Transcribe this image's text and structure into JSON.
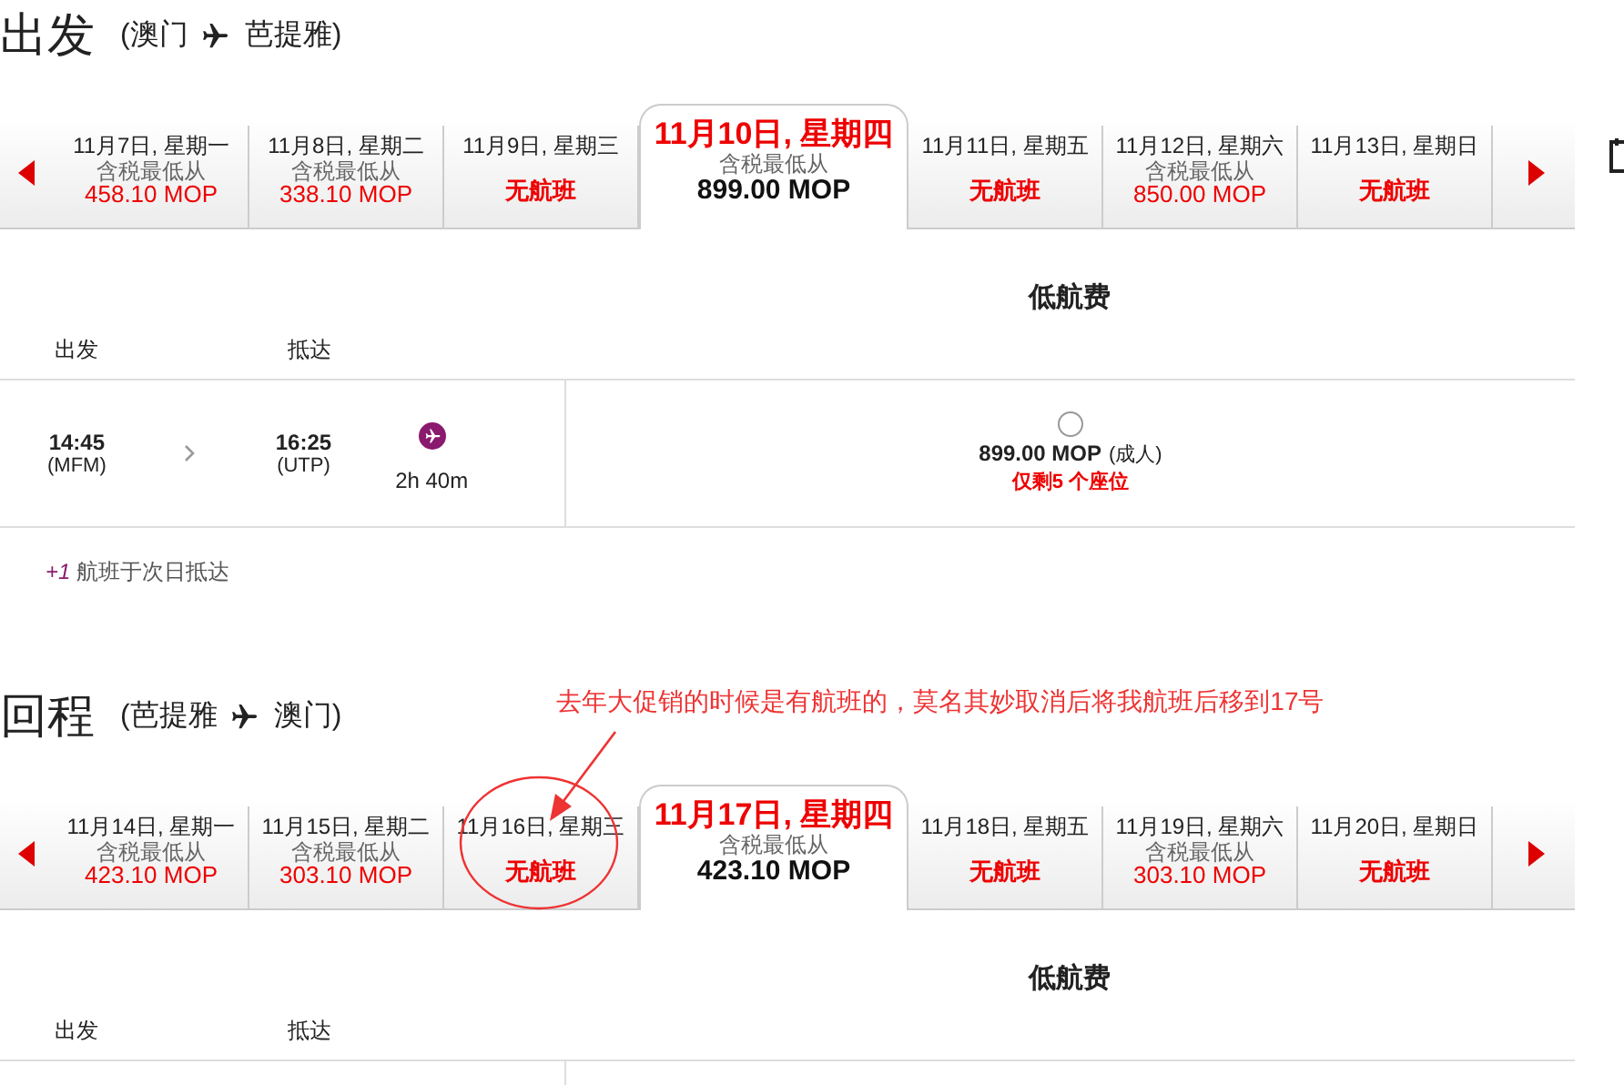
{
  "sections": [
    {
      "title": "出发",
      "route": {
        "from": "(澳门",
        "to": "芭提雅)"
      },
      "dates": [
        {
          "date": "11月7日, 星期一",
          "kind": "fare",
          "label": "含税最低从",
          "price": "458.10 MOP",
          "selected": false
        },
        {
          "date": "11月8日, 星期二",
          "kind": "fare",
          "label": "含税最低从",
          "price": "338.10 MOP",
          "selected": false
        },
        {
          "date": "11月9日, 星期三",
          "kind": "none",
          "status": "无航班",
          "selected": false
        },
        {
          "date": "11月10日, 星期四",
          "kind": "fare",
          "label": "含税最低从",
          "price": "899.00 MOP",
          "selected": true
        },
        {
          "date": "11月11日, 星期五",
          "kind": "none",
          "status": "无航班",
          "selected": false
        },
        {
          "date": "11月12日, 星期六",
          "kind": "fare",
          "label": "含税最低从",
          "price": "850.00 MOP",
          "selected": false
        },
        {
          "date": "11月13日, 星期日",
          "kind": "none",
          "status": "无航班",
          "selected": false
        }
      ],
      "fare_header": "低航费",
      "columns": [
        "出发",
        "抵达"
      ],
      "flights": [
        {
          "depart_time": "14:45",
          "depart_code": "(MFM)",
          "arrive_time": "16:25",
          "arrive_code": "(UTP)",
          "duration": "2h 40m",
          "price": "899.00 MOP",
          "pax": "(成人)",
          "seats_left": "仅剩5 个座位",
          "selected": false
        }
      ],
      "note": {
        "mark": "+1",
        "text": "航班于次日抵达"
      }
    },
    {
      "title": "回程",
      "route": {
        "from": "(芭提雅",
        "to": "澳门)"
      },
      "annotation": "去年大促销的时候是有航班的，莫名其妙取消后将我航班后移到17号",
      "dates": [
        {
          "date": "11月14日, 星期一",
          "kind": "fare",
          "label": "含税最低从",
          "price": "423.10 MOP",
          "selected": false,
          "circled": false
        },
        {
          "date": "11月15日, 星期二",
          "kind": "fare",
          "label": "含税最低从",
          "price": "303.10 MOP",
          "selected": false,
          "circled": false
        },
        {
          "date": "11月16日, 星期三",
          "kind": "none",
          "status": "无航班",
          "selected": false,
          "circled": true
        },
        {
          "date": "11月17日, 星期四",
          "kind": "fare",
          "label": "含税最低从",
          "price": "423.10 MOP",
          "selected": true,
          "circled": false
        },
        {
          "date": "11月18日, 星期五",
          "kind": "none",
          "status": "无航班",
          "selected": false,
          "circled": false
        },
        {
          "date": "11月19日, 星期六",
          "kind": "fare",
          "label": "含税最低从",
          "price": "303.10 MOP",
          "selected": false,
          "circled": false
        },
        {
          "date": "11月20日, 星期日",
          "kind": "none",
          "status": "无航班",
          "selected": false,
          "circled": false
        }
      ],
      "fare_header": "低航费",
      "columns": [
        "出发",
        "抵达"
      ]
    }
  ]
}
